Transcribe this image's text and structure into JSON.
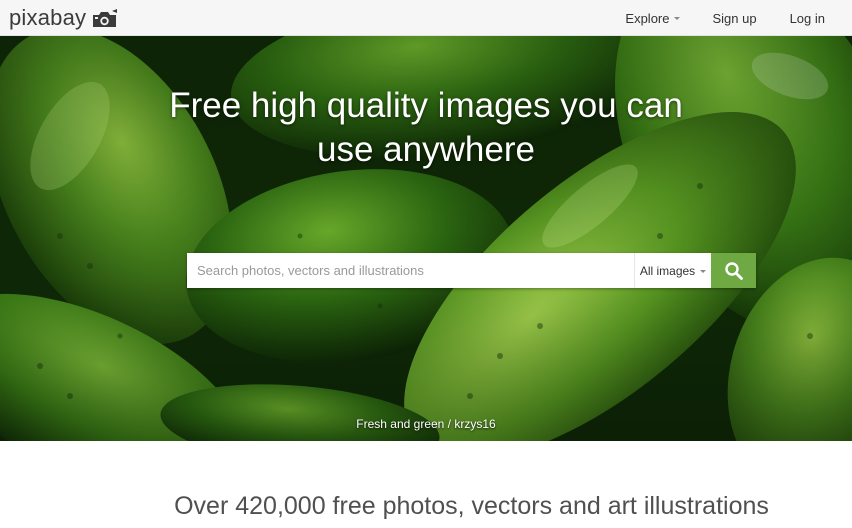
{
  "brand": {
    "logo_text": "pixabay",
    "logo_icon": "camera-icon"
  },
  "nav": {
    "explore_label": "Explore",
    "signup_label": "Sign up",
    "login_label": "Log in"
  },
  "hero": {
    "title_line1": "Free high quality images you can",
    "title_line2": "use anywhere",
    "search": {
      "placeholder": "Search photos, vectors and illustrations",
      "value": "",
      "type_selected": "All images",
      "button_icon": "search-icon"
    },
    "credit": {
      "title": "Fresh and green",
      "separator": " / ",
      "author": "krzys16"
    }
  },
  "tagline": "Over 420,000 free photos, vectors and art illustrations",
  "colors": {
    "accent": "#6ea944",
    "topbar_bg": "#f6f6f6",
    "text": "#333333"
  }
}
